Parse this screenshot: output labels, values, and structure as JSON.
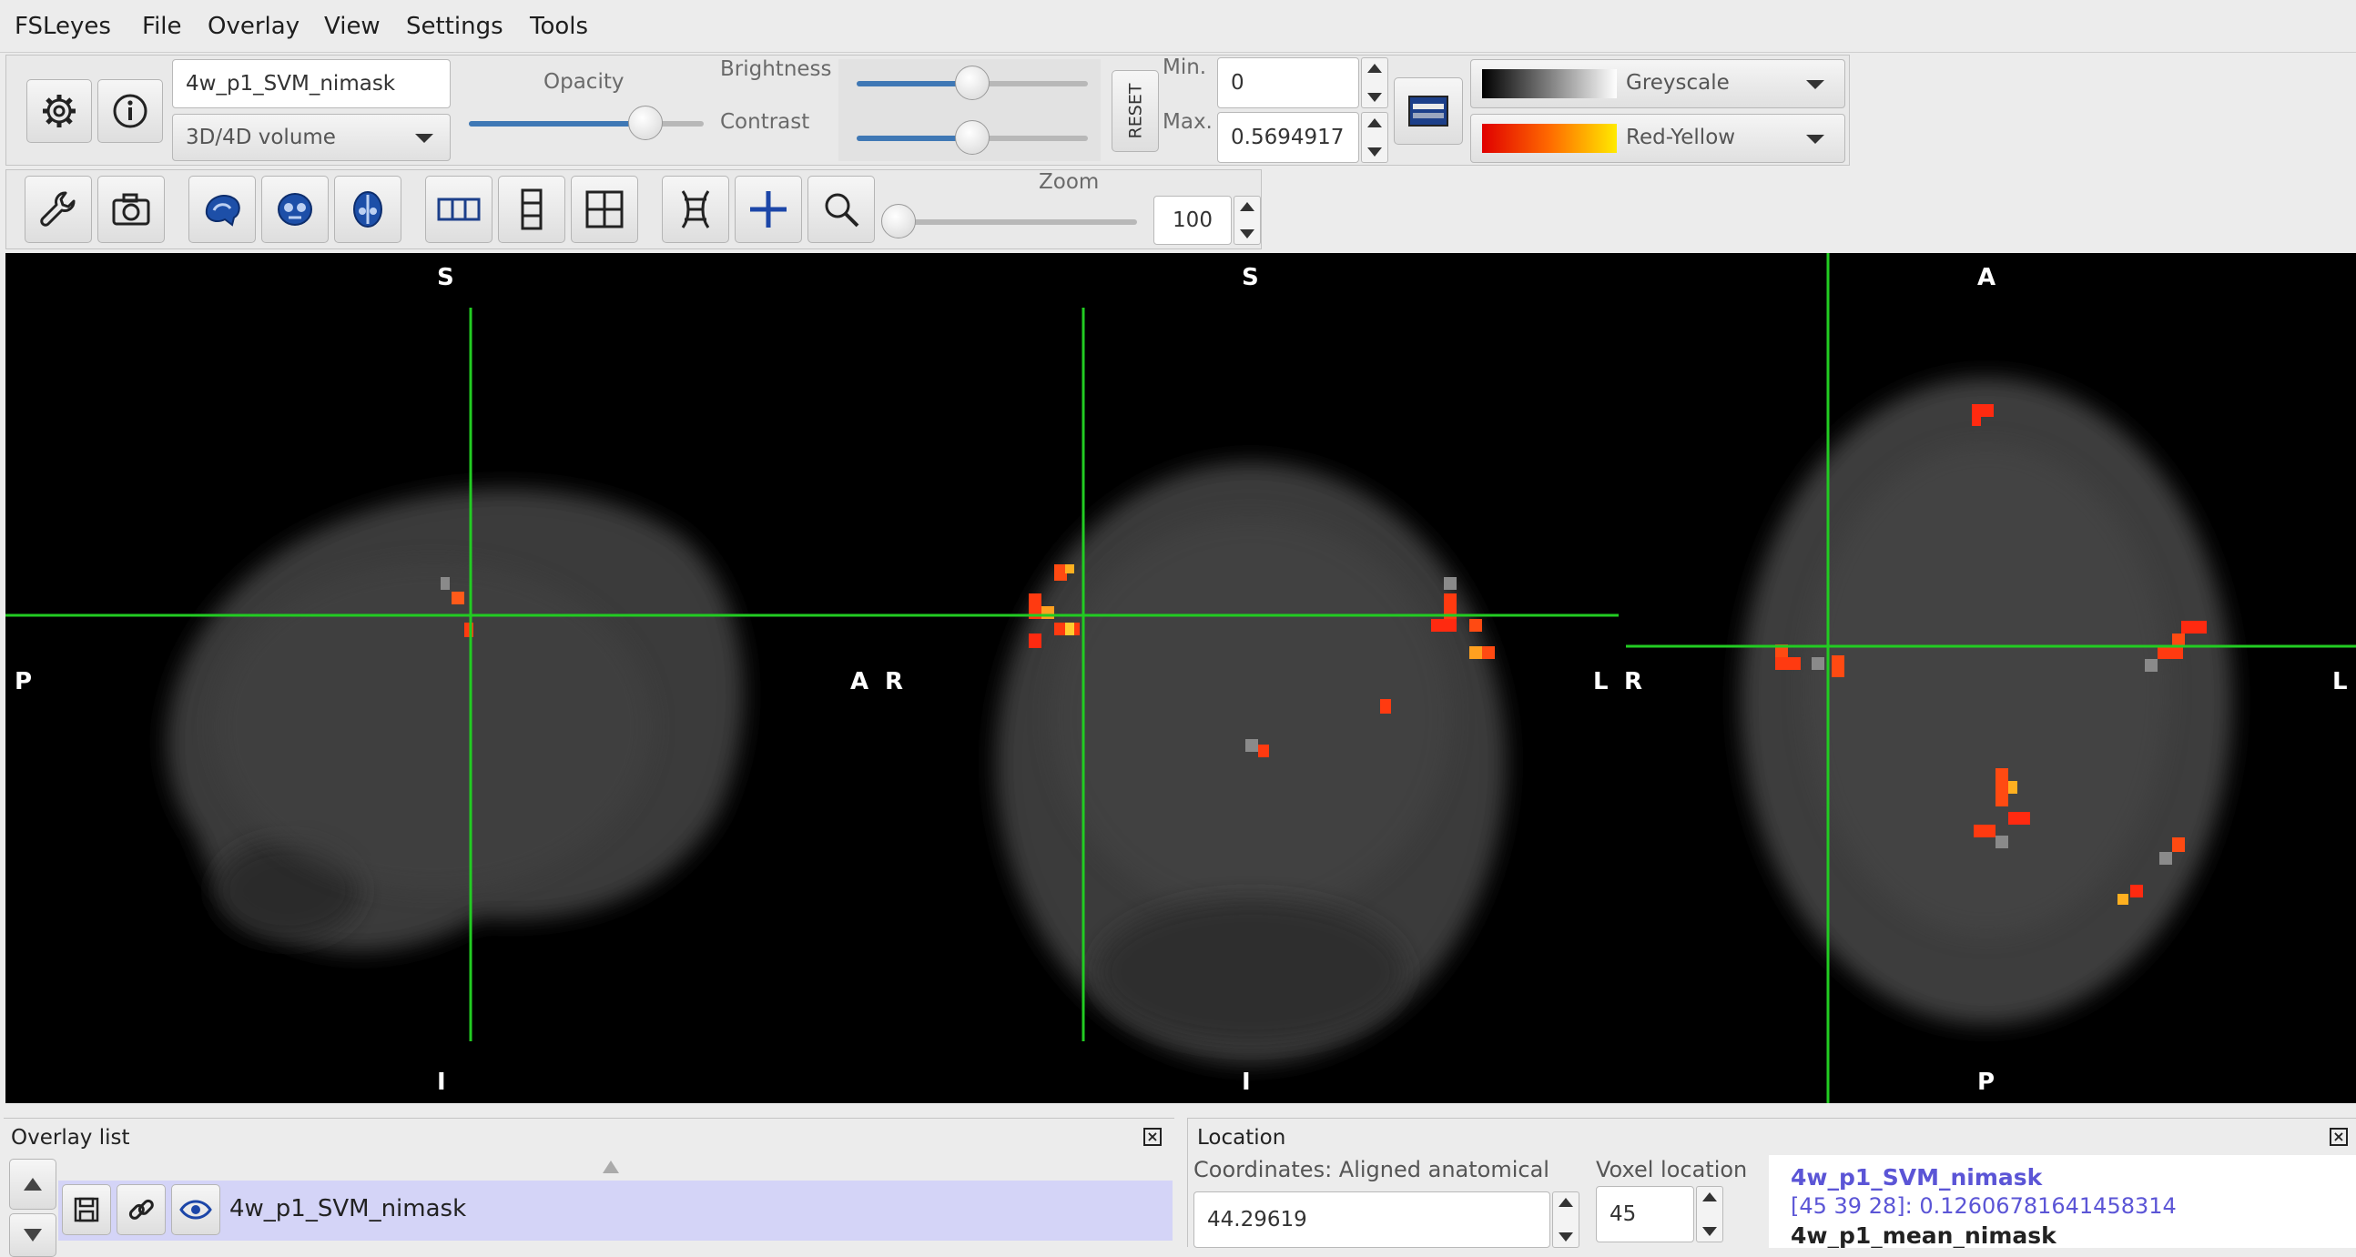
{
  "menubar": {
    "items": [
      "FSLeyes",
      "File",
      "Overlay",
      "View",
      "Settings",
      "Tools"
    ]
  },
  "overlay_toolbar": {
    "overlay_name": "4w_p1_SVM_nimask",
    "overlay_type": "3D/4D volume",
    "opacity_label": "Opacity",
    "opacity": 0.75,
    "brightness_label": "Brightness",
    "brightness": 0.5,
    "contrast_label": "Contrast",
    "contrast": 0.5,
    "reset_label": "RESET",
    "min_label": "Min.",
    "min_value": "0",
    "max_label": "Max.",
    "max_value": "0.5694917",
    "colormap_1": "Greyscale",
    "colormap_2": "Red-Yellow"
  },
  "ortho_toolbar": {
    "zoom_label": "Zoom",
    "zoom_value": "100",
    "zoom": 0.0
  },
  "views": {
    "sagittal": {
      "top": "S",
      "bottom": "I",
      "left": "P",
      "right": "A"
    },
    "coronal": {
      "top": "S",
      "bottom": "I",
      "left": "R",
      "right": "L"
    },
    "axial": {
      "top": "A",
      "bottom": "P",
      "left": "R",
      "right": "L"
    }
  },
  "overlay_list": {
    "title": "Overlay list",
    "items": [
      {
        "name": "4w_p1_SVM_nimask"
      }
    ]
  },
  "location": {
    "title": "Location",
    "coords_label": "Coordinates: Aligned anatomical",
    "coord_x": "44.29619",
    "voxel_label": "Voxel location",
    "voxel_x": "45",
    "info_name_1": "4w_p1_SVM_nimask",
    "info_value_1": "[45 39 28]: 0.12606781641458314",
    "info_name_2": "4w_p1_mean_nimask"
  },
  "colors": {
    "cursor": "#22cc22",
    "selection": "#d4d4f7",
    "info_blue": "#5b55d6",
    "accent": "#3f78b5"
  }
}
